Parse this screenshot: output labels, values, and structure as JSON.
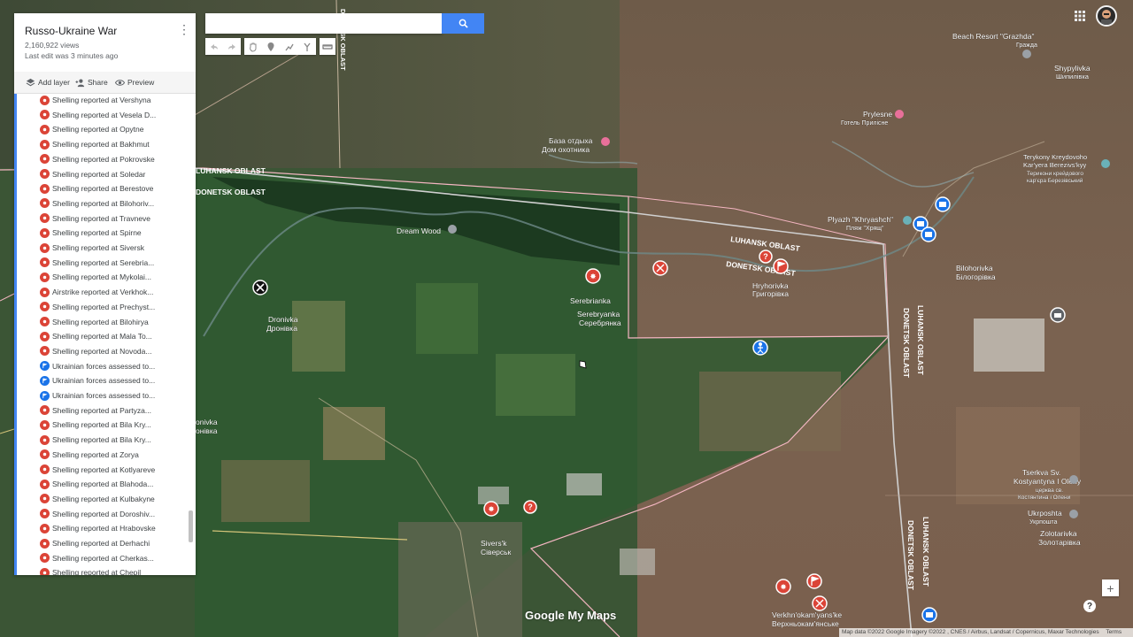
{
  "panel": {
    "title": "Russo-Ukraine War",
    "views": "2,160,922 views",
    "last_edit": "Last edit was 3 minutes ago",
    "add_layer": "Add layer",
    "share": "Share",
    "preview": "Preview",
    "items": [
      {
        "label": "Shelling reported at Vershyna",
        "icon": "red"
      },
      {
        "label": "Shelling reported at Vesela D...",
        "icon": "red"
      },
      {
        "label": "Shelling reported at Opytne",
        "icon": "red"
      },
      {
        "label": "Shelling reported at Bakhmut",
        "icon": "red"
      },
      {
        "label": "Shelling reported at Pokrovske",
        "icon": "red"
      },
      {
        "label": "Shelling reported at Soledar",
        "icon": "red"
      },
      {
        "label": "Shelling reported at Berestove",
        "icon": "red"
      },
      {
        "label": "Shelling reported at Bilohoriv...",
        "icon": "red"
      },
      {
        "label": "Shelling reported at Travneve",
        "icon": "red"
      },
      {
        "label": "Shelling reported at Spirne",
        "icon": "red"
      },
      {
        "label": "Shelling reported at Siversk",
        "icon": "red"
      },
      {
        "label": "Shelling reported at Serebria...",
        "icon": "red"
      },
      {
        "label": "Shelling reported at Mykolai...",
        "icon": "red"
      },
      {
        "label": "Airstrike reported at Verkhok...",
        "icon": "red"
      },
      {
        "label": "Shelling reported at Prechyst...",
        "icon": "red"
      },
      {
        "label": "Shelling reported at Bilohirya",
        "icon": "red"
      },
      {
        "label": "Shelling reported at Mala To...",
        "icon": "red"
      },
      {
        "label": "Shelling reported at Novoda...",
        "icon": "red"
      },
      {
        "label": "Ukrainian forces assessed to...",
        "icon": "blue"
      },
      {
        "label": "Ukrainian forces assessed to...",
        "icon": "blue"
      },
      {
        "label": "Ukrainian forces assessed to...",
        "icon": "blue"
      },
      {
        "label": "Shelling reported at Partyza...",
        "icon": "red"
      },
      {
        "label": "Shelling reported at Bila Kry...",
        "icon": "red"
      },
      {
        "label": "Shelling reported at Bila Kry...",
        "icon": "red"
      },
      {
        "label": "Shelling reported at Zorya",
        "icon": "red"
      },
      {
        "label": "Shelling reported at Kotlyareve",
        "icon": "red"
      },
      {
        "label": "Shelling reported at Blahoda...",
        "icon": "red"
      },
      {
        "label": "Shelling reported at Kulbakyne",
        "icon": "red"
      },
      {
        "label": "Shelling reported at Doroshiv...",
        "icon": "red"
      },
      {
        "label": "Shelling reported at Hrabovske",
        "icon": "red"
      },
      {
        "label": "Shelling reported at Derhachi",
        "icon": "red"
      },
      {
        "label": "Shelling reported at Cherkas...",
        "icon": "red"
      },
      {
        "label": "Shelling reported at Chepil",
        "icon": "red"
      }
    ]
  },
  "map_labels": {
    "beach_resort": "Beach Resort \"Grazhda\"",
    "beach_resort_ua": "Гражда",
    "shypylivka": "Shypylivka",
    "shypylivka_ua": "Шипилівка",
    "prylesne": "Prylesne",
    "prylesne_ua": "Готель Прилісне",
    "baza": "База отдыха",
    "baza2": "Дом охотника",
    "terykony": "Terykony Kreydovoho",
    "terykony2": "Kar'yera Berezivs'kyy",
    "terykony3": "Терикони крейдового",
    "terykony4": "кар'єра Березівський",
    "luhansk_oblast": "LUHANSK OBLAST",
    "donetsk_oblast": "DONETSK OBLAST",
    "plyazh": "Plyazh \"Khryashch\"",
    "plyazh_ua": "Пляж \"Хрящ\"",
    "dream_wood": "Dream Wood",
    "serebrianka": "Serebrianka",
    "serebryanka": "Serebryanka",
    "serebryanka_ua": "Серебрянка",
    "hryhorivka": "Hryhorivka",
    "hryhorivka_ua": "Григорівка",
    "bilohorivka": "Bilohorivka",
    "bilohorivka_ua": "Білогорівка",
    "dronivka": "Dronivka",
    "dronivka_ua": "Дронівка",
    "partial_nivka": "onivka",
    "partial_nivka_ua": "онівка",
    "siversk": "Sivers'k",
    "siversk_ua": "Сіверськ",
    "tserkva": "Tserkva Sv.",
    "tserkva2": "Kostyantyna I Oleny",
    "tserkva3": "церква св.",
    "tserkva4": "Костянтина і Олени",
    "ukrposhta": "Ukrposhta",
    "ukrposhta_ua": "Укрпошта",
    "zolotarivka": "Zolotarivka",
    "zolotarivka_ua": "Золотарівка",
    "verkhn": "Verkhn'okam'yans'ke",
    "verkhn_ua": "Верхньокам'янське"
  },
  "attribution": "Map data ©2022 Google Imagery ©2022 , CNES / Airbus, Landsat / Copernicus, Maxar Technologies",
  "terms": "Terms",
  "logo": "Google My Maps",
  "colors": {
    "accent": "#4285f4",
    "marker_red": "#db4437",
    "marker_blue": "#1a73e8",
    "border_pink": "#f4b6c2"
  }
}
